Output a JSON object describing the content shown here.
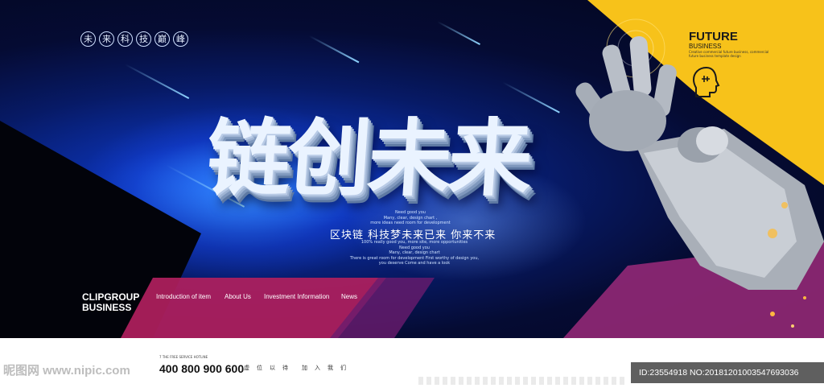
{
  "logo": {
    "chars": [
      "未",
      "来",
      "科",
      "技",
      "巅",
      "峰"
    ]
  },
  "headline": "链创未来",
  "small_text_top": [
    "Need good you",
    "Many, clear, design chart ,",
    "more ideas need room for development",
    "First worthy of design you, you deserve"
  ],
  "slogan": "区块链  科技梦未来已来  你来不来",
  "small_text_bottom": [
    "100% really good you, more site, more opportunities",
    "Need good you",
    "Many, clear, design chart",
    "There is great room for development First worthy of design you, you deserve Come and have a look"
  ],
  "future": {
    "title": "FUTURE",
    "subtitle": "BUSINESS",
    "small": "Creative commercial future business, commercial future business template design"
  },
  "brand": {
    "line1": "CLIPGROUP",
    "line2": "BUSINESS"
  },
  "nav": [
    "Introduction of item",
    "About Us",
    "Investment Information",
    "News"
  ],
  "footer": {
    "hotline_label": "7 THE FREE SERVICE HOTLINE",
    "phone": "400 800 900 600",
    "chars_a": [
      "虚",
      "位",
      "以",
      "待"
    ],
    "chars_b": [
      "加",
      "入",
      "我",
      "们"
    ],
    "watermark": "昵图网 www.nipic.com",
    "id_text": "ID:23554918 NO:20181201003547693036"
  },
  "colors": {
    "yellow": "#f7c21a",
    "magenta": "#b0205e",
    "navy": "#050b33",
    "blue": "#1f6bff"
  }
}
